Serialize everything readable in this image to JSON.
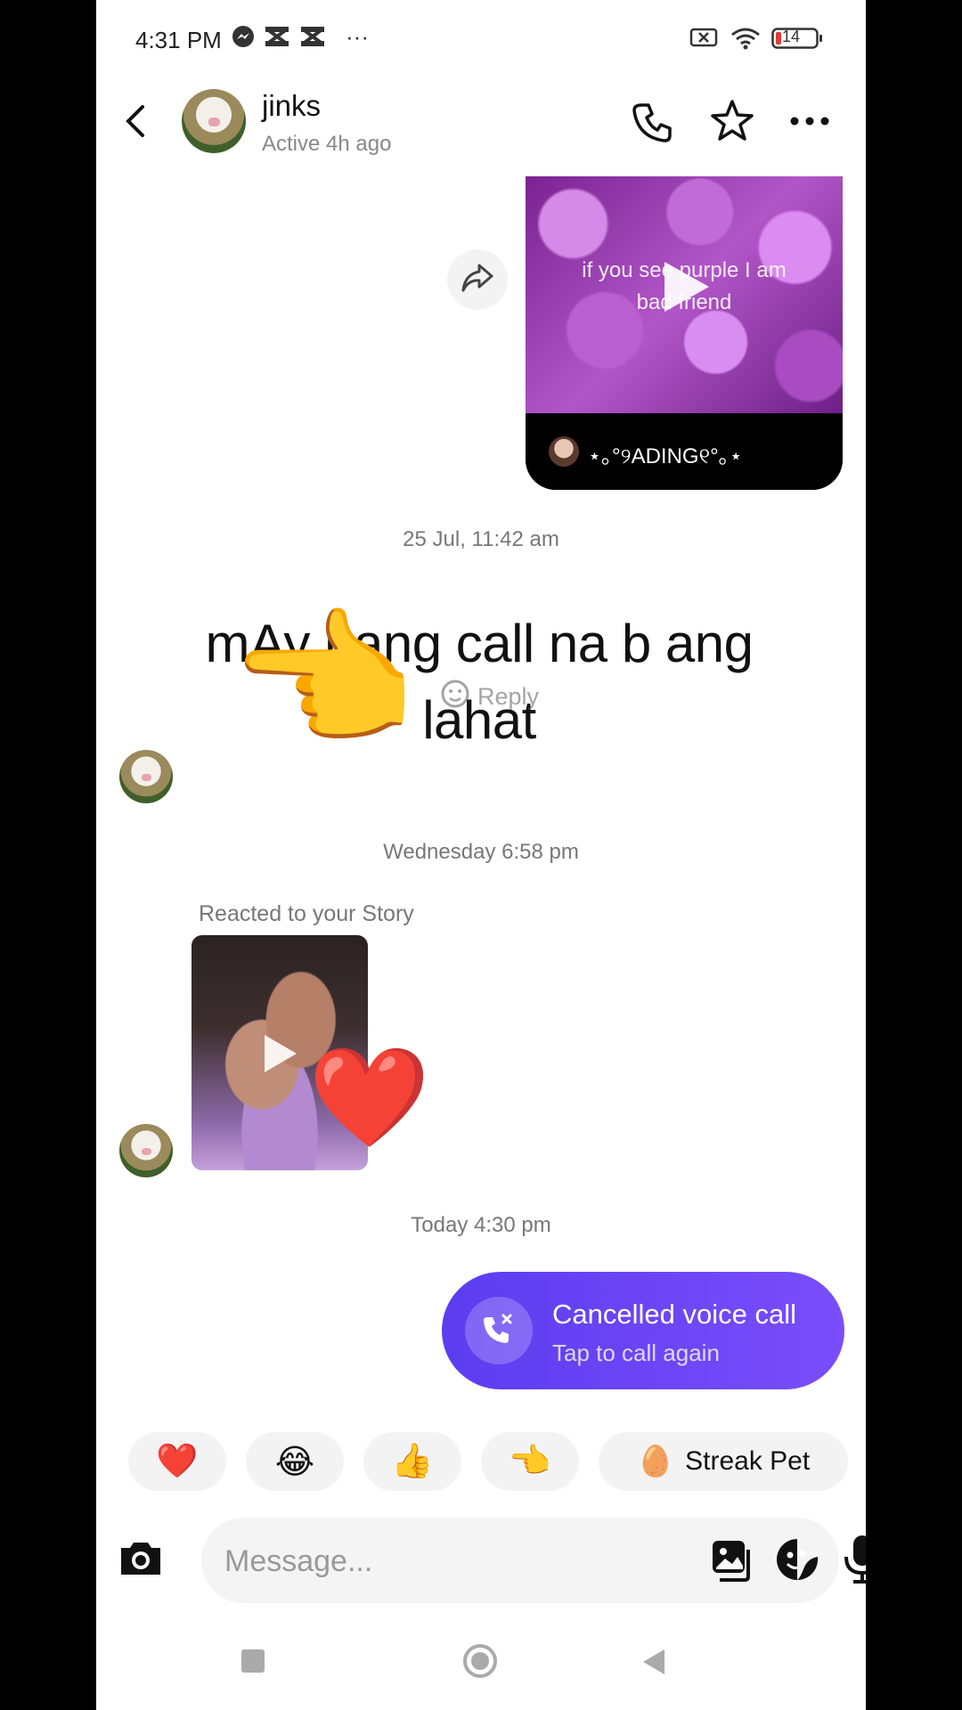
{
  "status_bar": {
    "time": "4:31 PM",
    "more": "···",
    "battery": "14",
    "icons": [
      "messenger-icon",
      "capcut-icon",
      "capcut-icon",
      "sim-off-icon",
      "wifi-icon",
      "battery-icon"
    ]
  },
  "header": {
    "contact_name": "jinks",
    "contact_status": "Active 4h ago",
    "icons": [
      "back-arrow-icon",
      "phone-icon",
      "star-icon",
      "more-icon"
    ]
  },
  "shared_post": {
    "overlay_text": "if you see purple I am bad friend",
    "author": "⋆｡°୨ADING୧°｡⋆"
  },
  "timestamps": {
    "first": "25 Jul, 11:42 am",
    "second": "Wednesday 6:58 pm",
    "third": "Today 4:30 pm"
  },
  "text_message": {
    "text": "mAy pang call na b ang lahat",
    "reaction": "👈",
    "reply_label": "Reply"
  },
  "story_reaction": {
    "label": "Reacted to your Story",
    "reaction": "❤️"
  },
  "call_bubble": {
    "title": "Cancelled voice call",
    "subtitle": "Tap to call again"
  },
  "quick_reactions": {
    "items": [
      "❤️",
      "😂",
      "👍",
      "👈"
    ],
    "streak_emoji": "🥚",
    "streak_label": "Streak Pet"
  },
  "composer": {
    "placeholder": "Message..."
  },
  "colors": {
    "accent": "#6a45f5",
    "background": "#ffffff"
  }
}
